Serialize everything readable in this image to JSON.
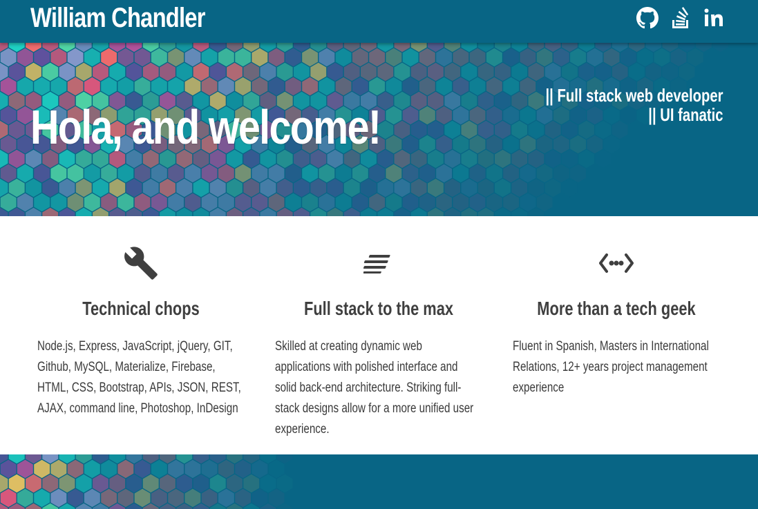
{
  "navbar": {
    "brand": "William Chandler",
    "icons": [
      "github-icon",
      "stack-overflow-icon",
      "linkedin-icon"
    ]
  },
  "hero": {
    "title": "Hola, and welcome!",
    "tagline_line1": "|| Full stack web developer",
    "tagline_line2": "|| UI fanatic"
  },
  "features": [
    {
      "icon": "wrench-icon",
      "title": "Technical chops",
      "text": "Node.js, Express, JavaScript, jQuery, GIT, Github, MySQL, Materialize, Firebase, HTML, CSS, Bootstrap, APIs, JSON, REST, AJAX, command line, Photoshop, InDesign"
    },
    {
      "icon": "text-lines-icon",
      "title": "Full stack to the max",
      "text": "Skilled at creating dynamic web applications with polished interface and solid back-end architecture. Striking full-stack designs allow for a more unified user experience."
    },
    {
      "icon": "code-arrows-icon",
      "title": "More than a tech geek",
      "text": "Fluent in Spanish, Masters in International Relations, 12+ years project management experience"
    }
  ],
  "colors": {
    "navbar": "#086585",
    "hero_base": "#086585",
    "text_dark": "#3f3f3f",
    "hex_palette": [
      "#1fd1c4",
      "#58e0a8",
      "#f6c85f",
      "#ff6b6b",
      "#f2557a",
      "#c94f9e",
      "#6b4fa0",
      "#9aa0d6"
    ]
  }
}
